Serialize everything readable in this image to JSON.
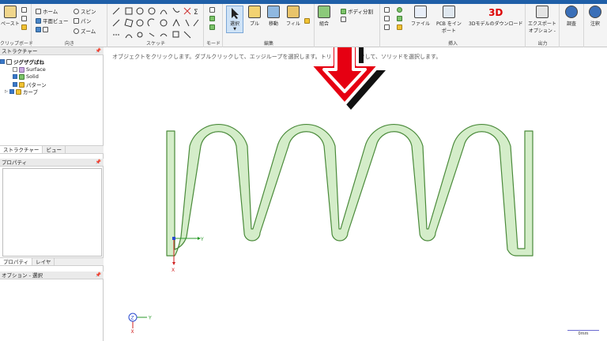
{
  "ribbon": {
    "clipboard": {
      "paste_label": "ペースト",
      "group_label": "クリップボード"
    },
    "orient": {
      "home_label": "ホーム",
      "plane_view_label": "平面ビュー",
      "spin_label": "スピン",
      "pan_label": "パン",
      "zoom_label": "ズーム",
      "group_label": "向き"
    },
    "sketch": {
      "group_label": "スケッチ"
    },
    "mode": {
      "group_label": "モード"
    },
    "edit": {
      "select_label": "選択",
      "pull_label": "プル",
      "move_label": "移動",
      "fill_label": "フィル",
      "group_label": "編集"
    },
    "intersect": {
      "combine_label": "組合",
      "split_body_label": "ボディ分割"
    },
    "insert": {
      "file_label": "ファイル",
      "pcb_label_1": "PCB をイン",
      "pcb_label_2": "ポート",
      "download_label": "3Dモデルのダウンロード",
      "group_label": "挿入",
      "logo_text": "3D"
    },
    "output": {
      "export_label": "エクスポート",
      "options_label": "オプション -",
      "group_label": "出力"
    },
    "investigate_label": "調査",
    "annotate_label": "注釈"
  },
  "structure": {
    "title": "ストラクチャー",
    "root": "ジグザグばね",
    "items": [
      "Surface",
      "Solid",
      "パターン",
      "カーブ"
    ]
  },
  "left_tabs": {
    "structure": "ストラクチャー",
    "view": "ビュー"
  },
  "properties": {
    "title": "プロパティ"
  },
  "prop_tabs": {
    "properties": "プロパティ",
    "layer": "レイヤ"
  },
  "options_panel": {
    "title": "オプション - 選択"
  },
  "canvas": {
    "hint": "オブジェクトをクリックします。ダブルクリックして、エッジループを選択します。トリプルクリックして、ソリッドを選択します。",
    "axis_y": "Y",
    "axis_x": "X",
    "axis_z": "Z",
    "scale_label": "0mm"
  },
  "colors": {
    "spring_fill": "#d4edc9",
    "spring_stroke": "#4a8a3a",
    "arrow_red": "#e60012",
    "accent_blue": "#1f5fa8"
  }
}
